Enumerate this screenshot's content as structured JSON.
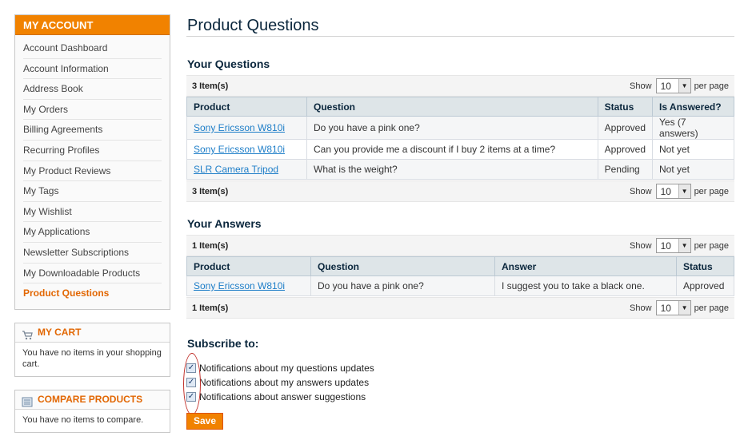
{
  "sidebar": {
    "account_title": "MY ACCOUNT",
    "items": [
      {
        "label": "Account Dashboard"
      },
      {
        "label": "Account Information"
      },
      {
        "label": "Address Book"
      },
      {
        "label": "My Orders"
      },
      {
        "label": "Billing Agreements"
      },
      {
        "label": "Recurring Profiles"
      },
      {
        "label": "My Product Reviews"
      },
      {
        "label": "My Tags"
      },
      {
        "label": "My Wishlist"
      },
      {
        "label": "My Applications"
      },
      {
        "label": "Newsletter Subscriptions"
      },
      {
        "label": "My Downloadable Products"
      },
      {
        "label": "Product Questions",
        "active": true
      }
    ],
    "cart": {
      "title": "MY CART",
      "icon": "cart-icon",
      "message": "You have no items in your shopping cart."
    },
    "compare": {
      "title": "COMPARE PRODUCTS",
      "icon": "compare-icon",
      "message": "You have no items to compare."
    }
  },
  "main": {
    "page_title": "Product Questions",
    "questions": {
      "title": "Your Questions",
      "count": "3 Item(s)",
      "show_label": "Show",
      "limit": "10",
      "per_page": "per page",
      "columns": [
        "Product",
        "Question",
        "Status",
        "Is Answered?"
      ],
      "rows": [
        [
          "Sony Ericsson W810i",
          "Do you have a pink one?",
          "Approved",
          "Yes (7 answers)"
        ],
        [
          "Sony Ericsson W810i",
          "Can you provide me a discount if I buy 2 items at a time?",
          "Approved",
          "Not yet"
        ],
        [
          "SLR Camera Tripod",
          "What is the weight?",
          "Pending",
          "Not yet"
        ]
      ]
    },
    "answers": {
      "title": "Your Answers",
      "count": "1 Item(s)",
      "show_label": "Show",
      "limit": "10",
      "per_page": "per page",
      "columns": [
        "Product",
        "Question",
        "Answer",
        "Status"
      ],
      "rows": [
        [
          "Sony Ericsson W810i",
          "Do you have a pink one?",
          "I suggest you to take a black one.",
          "Approved"
        ]
      ]
    },
    "subscribe": {
      "title": "Subscribe to:",
      "options": [
        {
          "label": "Notifications about my questions updates",
          "checked": true
        },
        {
          "label": "Notifications about my answers updates",
          "checked": true
        },
        {
          "label": "Notifications about answer suggestions",
          "checked": true
        }
      ],
      "save_label": "Save"
    }
  },
  "colors": {
    "accent": "#f18200",
    "link": "#1e7ec8",
    "heading": "#0a263c",
    "annotation": "#c0302a"
  }
}
